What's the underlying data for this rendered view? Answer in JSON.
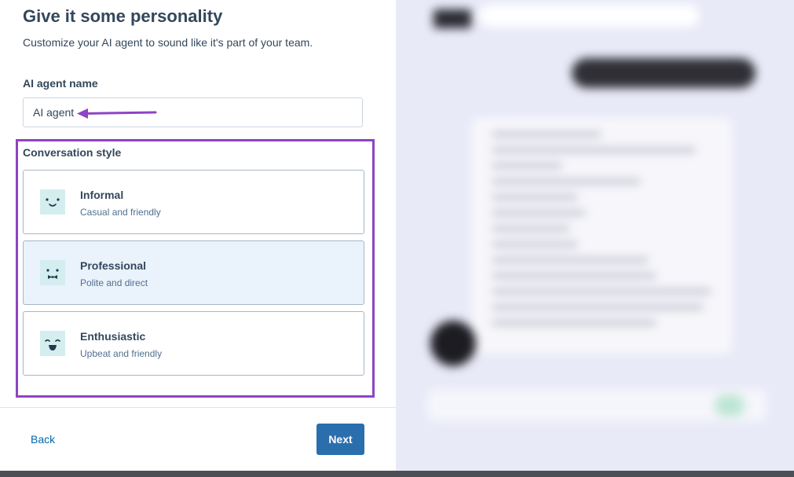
{
  "header": {
    "title": "Give it some personality",
    "subtitle": "Customize your AI agent to sound like it's part of your team."
  },
  "agent_name": {
    "label": "AI agent name",
    "value": "AI agent"
  },
  "conversation_style": {
    "label": "Conversation style",
    "options": [
      {
        "title": "Informal",
        "description": "Casual and friendly",
        "icon": "smiling-face-icon",
        "selected": false
      },
      {
        "title": "Professional",
        "description": "Polite and direct",
        "icon": "bowtie-face-icon",
        "selected": true
      },
      {
        "title": "Enthusiastic",
        "description": "Upbeat and friendly",
        "icon": "grinning-face-icon",
        "selected": false
      }
    ]
  },
  "footer": {
    "back_label": "Back",
    "next_label": "Next"
  },
  "colors": {
    "accent": "#2a6ead",
    "highlight": "#8e44c4",
    "selected_bg": "#eaf2fb"
  }
}
